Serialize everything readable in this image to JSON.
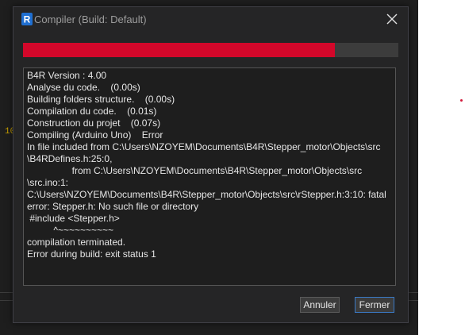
{
  "background": {
    "line_number_fragment": "10"
  },
  "dialog": {
    "title": "Compiler (Build: Default)",
    "app_icon": "b4r-logo-icon",
    "close_icon": "close-icon",
    "progress": 0.83,
    "colors": {
      "progress_fill": "#d3072a",
      "progress_track": "#3c3c3c",
      "accent_border": "#3a79c4"
    },
    "log_lines": [
      "B4R Version : 4.00",
      "Analyse du code.    (0.00s)",
      "Building folders structure.    (0.00s)",
      "Compilation du code.    (0.01s)",
      "Construction du projet    (0.07s)",
      "Compiling (Arduino Uno)    Error",
      "In file included from C:\\Users\\NZOYEM\\Documents\\B4R\\Stepper_motor\\Objects\\src",
      "\\B4RDefines.h:25:0,",
      "                 from C:\\Users\\NZOYEM\\Documents\\B4R\\Stepper_motor\\Objects\\src",
      "\\src.ino:1:",
      "C:\\Users\\NZOYEM\\Documents\\B4R\\Stepper_motor\\Objects\\src\\rStepper.h:3:10: fatal",
      "error: Stepper.h: No such file or directory",
      " #include <Stepper.h>",
      "          ^~~~~~~~~~~",
      "compilation terminated.",
      "Error during build: exit status 1"
    ],
    "buttons": {
      "cancel_label": "Annuler",
      "close_label": "Fermer"
    }
  }
}
